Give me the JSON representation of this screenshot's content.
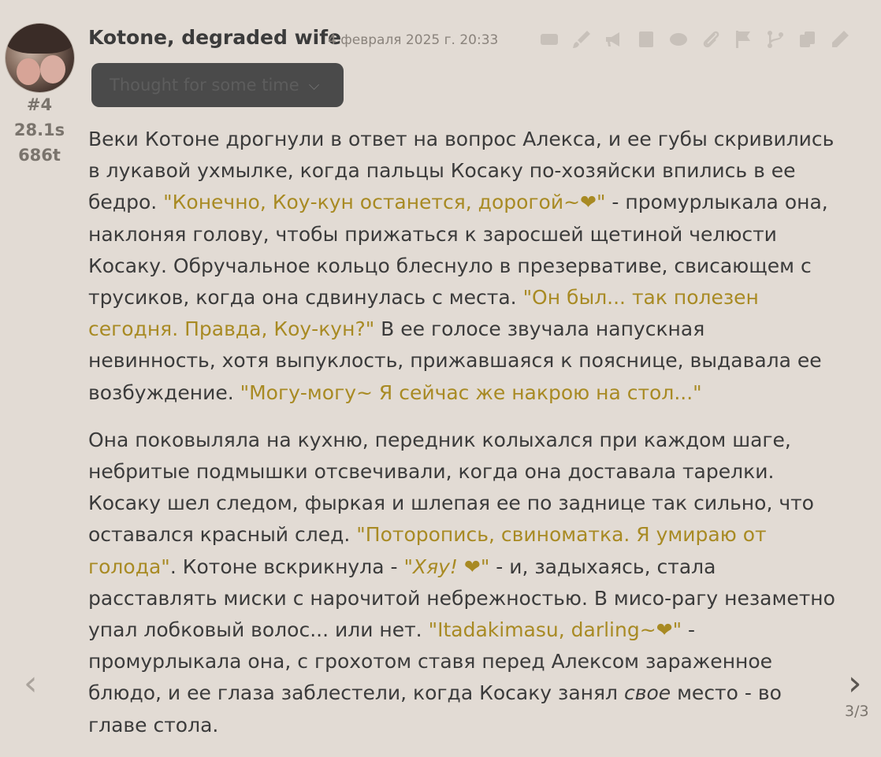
{
  "message": {
    "index": "#4",
    "time": "28.1s",
    "tokens": "686t",
    "author": "Kotone, degraded wife",
    "date": "4 февраля 2025 г. 20:33",
    "reasoning_label": "Thought for some time",
    "paragraphs": [
      [
        {
          "t": "Веки Котоне дрогнули в ответ на вопрос Алекса, и ее губы скривились в лукавой ухмылке, когда пальцы Косаку по-хозяйски впились в ее бедро. "
        },
        {
          "t": "\"Конечно, Коу-кун останется, дорогой~❤\"",
          "style": "q"
        },
        {
          "t": " - промурлыкала она, наклоняя голову, чтобы прижаться к заросшей щетиной челюсти Косаку. Обручальное кольцо блеснуло в презервативе, свисающем с трусиков, когда она сдвинулась с места. "
        },
        {
          "t": "\"Он был... так полезен сегодня. Правда, Коу-кун?\"",
          "style": "q"
        },
        {
          "t": " В ее голосе звучала напускная невинность, хотя выпуклость, прижавшаяся к пояснице, выдавала ее возбуждение. "
        },
        {
          "t": "\"Могу-могу~ Я сейчас же накрою на стол...\"",
          "style": "q"
        }
      ],
      [
        {
          "t": "Она поковыляла на кухню, передник колыхался при каждом шаге, небритые подмышки отсвечивали, когда она доставала тарелки. Косаку шел следом, фыркая и шлепая ее по заднице так сильно, что оставался красный след. "
        },
        {
          "t": "\"Поторопись, свиноматка. Я умираю от голода\"",
          "style": "q"
        },
        {
          "t": ". Котоне вскрикнула - "
        },
        {
          "t": "\"Хяу! ❤\"",
          "style": "qe"
        },
        {
          "t": " - и, задыхаясь, стала расставлять миски с нарочитой небрежностью. В мисо-рагу незаметно упал лобковый волос... или нет. "
        },
        {
          "t": "\"Itadakimasu, darling~❤\"",
          "style": "q"
        },
        {
          "t": " - промурлыкала она, с грохотом ставя перед Алексом зараженное блюдо, и ее глаза заблестели, когда Косаку занял "
        },
        {
          "t": "свое",
          "style": "em"
        },
        {
          "t": " место - во главе стола."
        }
      ]
    ]
  },
  "pager": "3/3",
  "toolbar": [
    {
      "name": "translate-icon"
    },
    {
      "name": "brush-icon"
    },
    {
      "name": "megaphone-icon"
    },
    {
      "name": "notes-icon"
    },
    {
      "name": "eye-icon"
    },
    {
      "name": "paperclip-icon"
    },
    {
      "name": "flag-icon"
    },
    {
      "name": "branch-icon"
    },
    {
      "name": "copy-icon"
    },
    {
      "name": "pencil-icon"
    }
  ],
  "nav": {
    "prev_icon": "chevron-left-icon",
    "next_icon": "chevron-right-icon"
  },
  "colors": {
    "background": "#e2dbd4",
    "quote": "#a88a23",
    "text": "#3b3b3b"
  }
}
